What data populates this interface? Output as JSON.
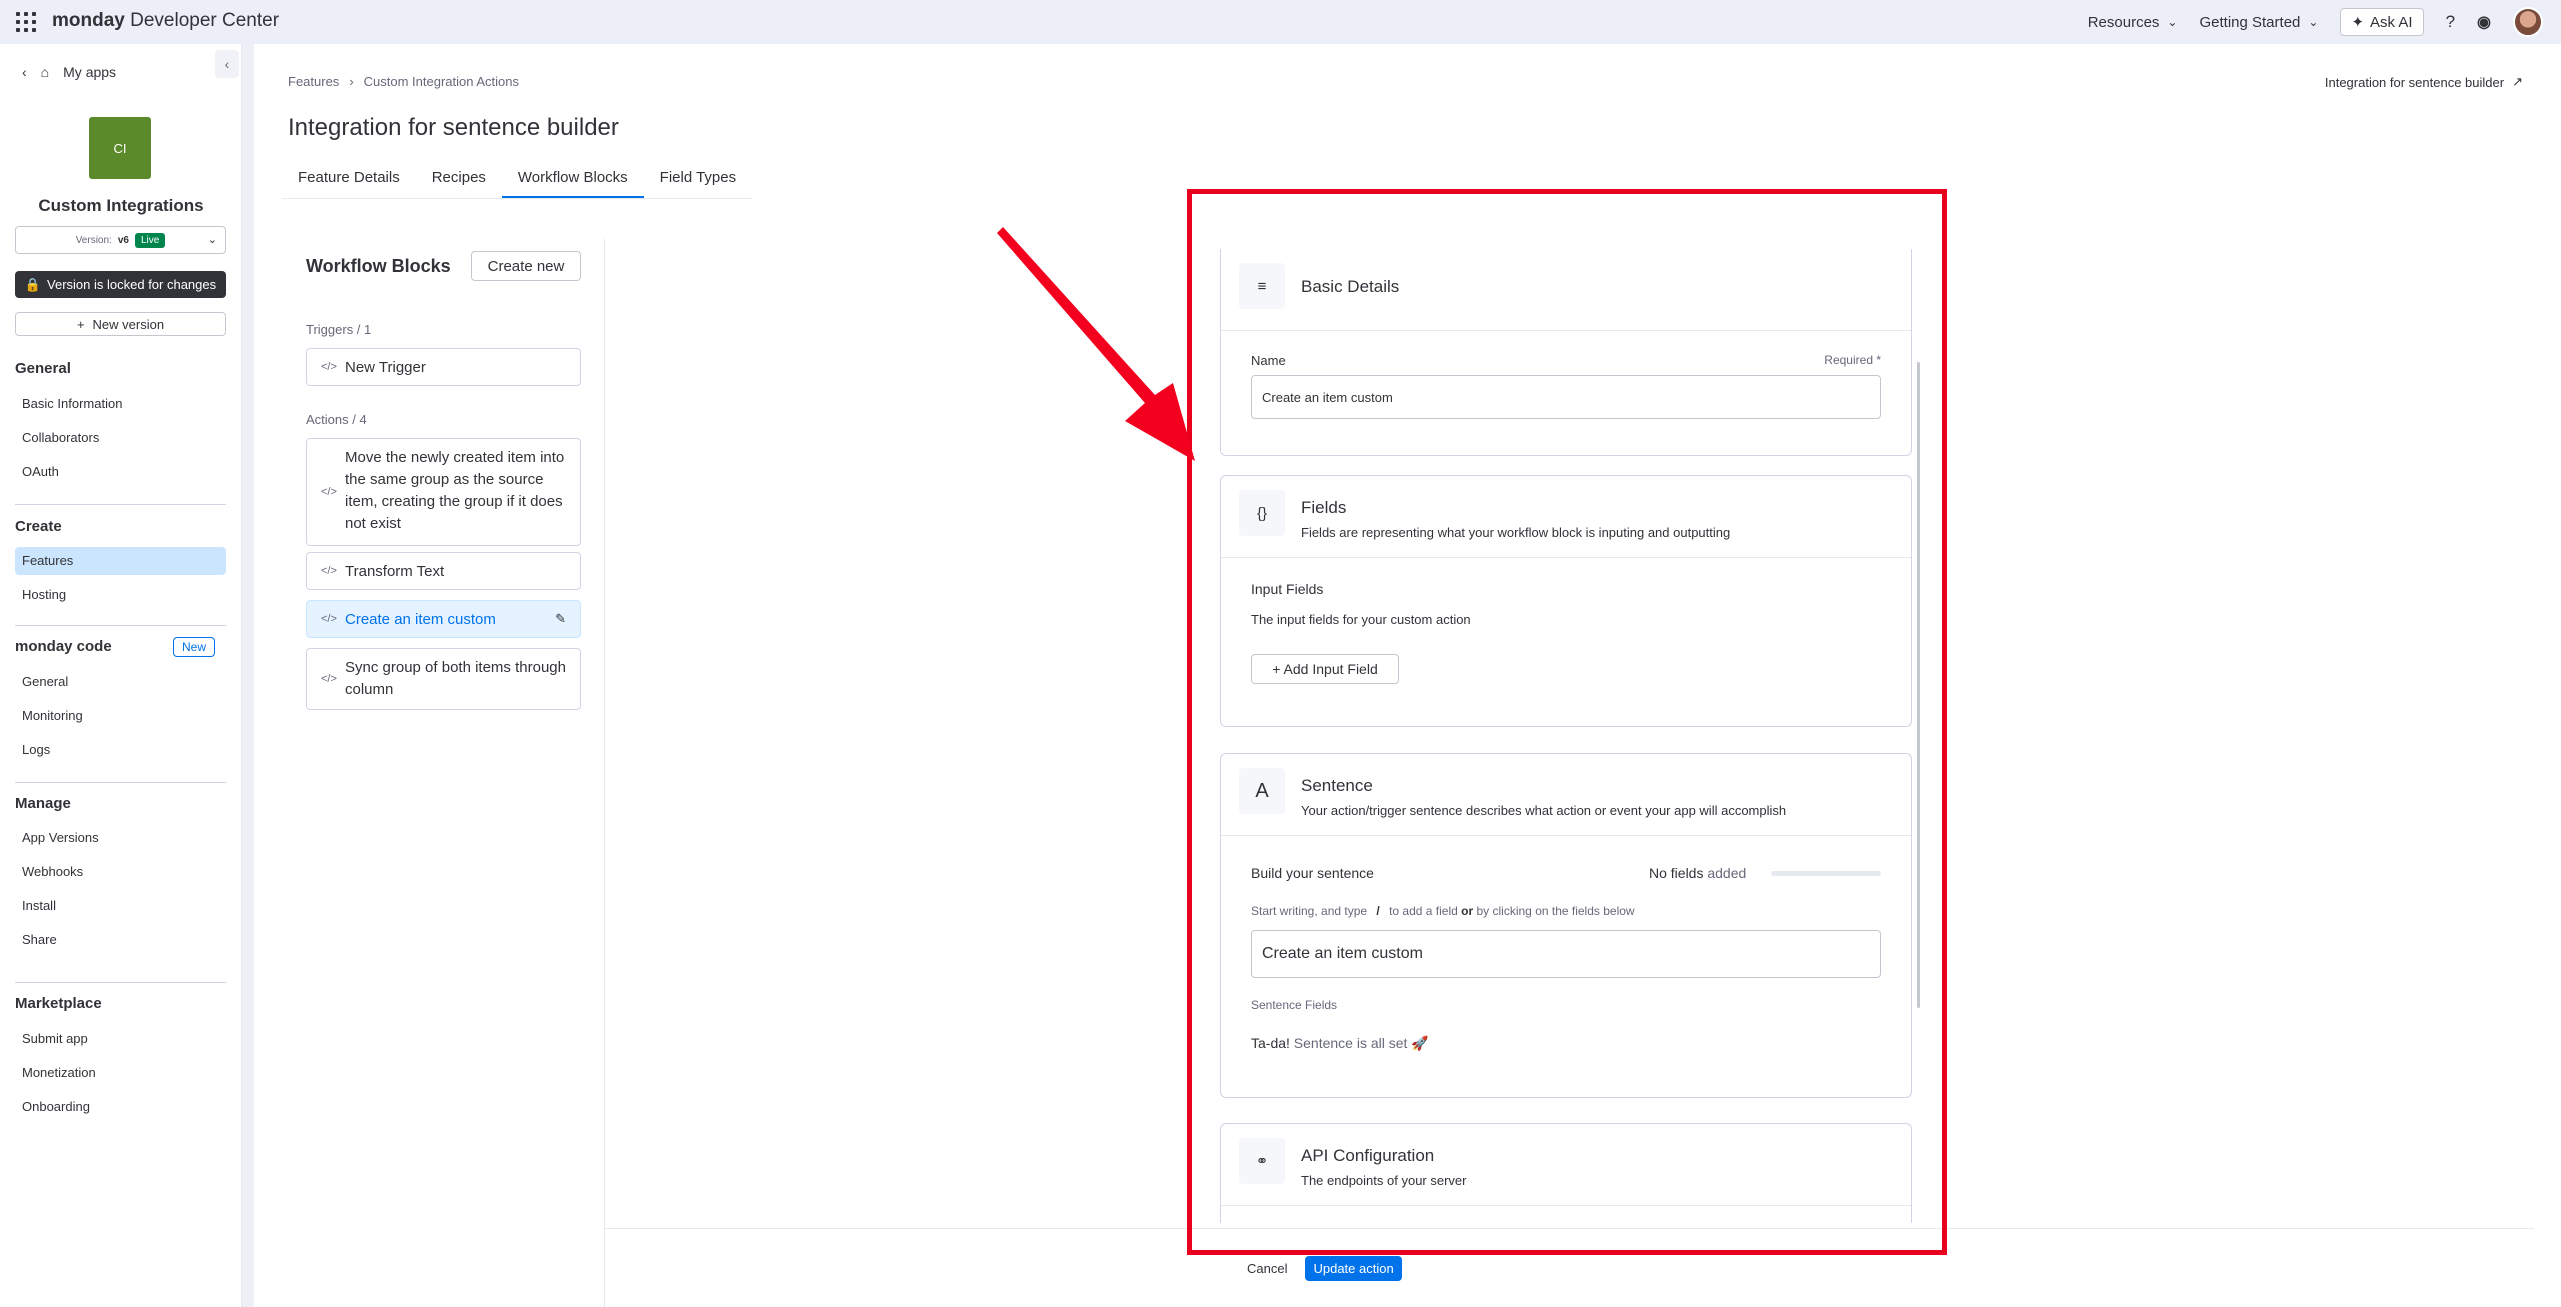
{
  "topbar": {
    "brand_bold": "monday",
    "brand_rest": " Developer Center",
    "resources": "Resources",
    "getting_started": "Getting Started",
    "ask_ai": "Ask AI"
  },
  "sidebar": {
    "back_label": "My apps",
    "app_logo_text": "CI",
    "app_name": "Custom Integrations",
    "version_prefix": "Version:",
    "version_value": "v6",
    "version_badge": "Live",
    "locked_label": "Version is locked for changes",
    "new_version": "New version",
    "sections": {
      "general": "General",
      "create": "Create",
      "monday_code": "monday code",
      "manage": "Manage",
      "marketplace": "Marketplace"
    },
    "new_badge": "New",
    "items": {
      "basic_information": "Basic Information",
      "collaborators": "Collaborators",
      "oauth": "OAuth",
      "features": "Features",
      "hosting": "Hosting",
      "mc_general": "General",
      "monitoring": "Monitoring",
      "logs": "Logs",
      "app_versions": "App Versions",
      "webhooks": "Webhooks",
      "install": "Install",
      "share": "Share",
      "submit_app": "Submit app",
      "monetization": "Monetization",
      "onboarding": "Onboarding"
    }
  },
  "main": {
    "breadcrumb_1": "Features",
    "breadcrumb_2": "Custom Integration Actions",
    "title": "Integration for sentence builder",
    "external_link": "Integration for sentence builder",
    "tabs": [
      "Feature Details",
      "Recipes",
      "Workflow Blocks",
      "Field Types"
    ],
    "workflow_title": "Workflow Blocks",
    "create_new": "Create new",
    "triggers_label": "Triggers / 1",
    "actions_label": "Actions / 4",
    "trigger_blocks": [
      "New Trigger"
    ],
    "action_blocks": [
      "Move the newly created item into the same group as the source item, creating the group if it does not exist",
      "Transform Text",
      "Create an item custom",
      "Sync group of both items through column"
    ]
  },
  "panel": {
    "basic": {
      "title": "Basic Details",
      "name_label": "Name",
      "required": "Required *",
      "name_value": "Create an item custom"
    },
    "fields": {
      "title": "Fields",
      "subtitle": "Fields are representing what your workflow block is inputing and outputting",
      "input_label": "Input Fields",
      "input_desc": "The input fields for your custom action",
      "add_button": "+ Add Input Field"
    },
    "sentence": {
      "title": "Sentence",
      "subtitle": "Your action/trigger sentence describes what action or event your app will accomplish",
      "build_label": "Build your sentence",
      "no_fields_bold": "No fields",
      "no_fields_rest": " added",
      "hint_1": "Start writing, and type",
      "hint_slash": "/",
      "hint_2": "to add a field",
      "hint_or": "or",
      "hint_3": "by clicking on the fields below",
      "sentence_value": "Create an item custom",
      "sentence_fields_label": "Sentence Fields",
      "tada_bold": "Ta-da!",
      "tada_rest": " Sentence is all set",
      "progress": 0
    },
    "api": {
      "title": "API Configuration",
      "subtitle": "The endpoints of your server"
    }
  },
  "footer": {
    "cancel": "Cancel",
    "update": "Update action"
  },
  "colors": {
    "accent": "#0073ea",
    "live": "#00854d",
    "highlight": "#e8001c",
    "logo": "#5b8a2a"
  }
}
